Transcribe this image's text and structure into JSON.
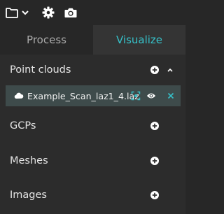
{
  "toolbar": {
    "icons": [
      "folder-icon",
      "chevron-down-icon",
      "gear-icon",
      "camera-icon"
    ]
  },
  "tabs": [
    {
      "label": "Process",
      "active": false
    },
    {
      "label": "Visualize",
      "active": true
    }
  ],
  "sections": [
    {
      "title": "Point clouds",
      "expanded": true,
      "items": [
        {
          "label": "Example_Scan_laz1_4.laz"
        }
      ]
    },
    {
      "title": "GCPs",
      "expanded": false
    },
    {
      "title": "Meshes",
      "expanded": false
    },
    {
      "title": "Images",
      "expanded": false
    }
  ],
  "colors": {
    "accent": "#36c0c8",
    "tab_bg_inactive": "#272727",
    "tab_bg_active": "#343434",
    "panel_bg": "#2c2c2c",
    "selected_row_bg": "#3e4b4b"
  }
}
